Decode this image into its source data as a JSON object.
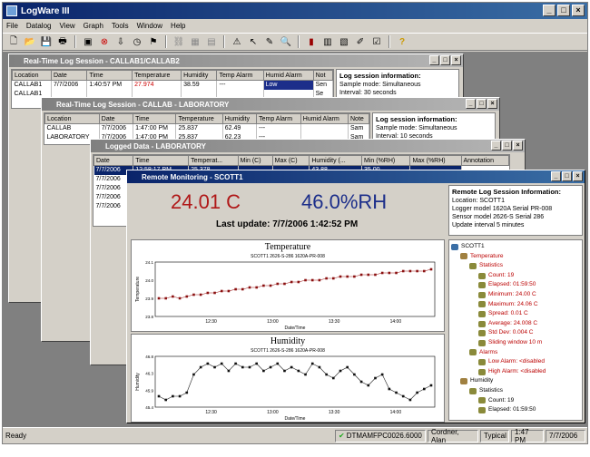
{
  "app": {
    "title": "LogWare III",
    "menu": [
      "File",
      "Datalog",
      "View",
      "Graph",
      "Tools",
      "Window",
      "Help"
    ]
  },
  "win1": {
    "title": "Real-Time Log Session - CALLAB1/CALLAB2",
    "cols": [
      "Location",
      "Date",
      "Time",
      "Temperature",
      "Humidity",
      "Temp Alarm",
      "Humid Alarm",
      "Not"
    ],
    "rows": [
      [
        "CALLAB1",
        "7/7/2006",
        "1:40:57 PM",
        "27.974",
        "38.59",
        "---",
        "Low",
        "Sen"
      ],
      [
        "CALLAB1",
        "",
        "",
        "",
        "",
        "",
        "",
        "Se"
      ]
    ],
    "info_title": "Log session information:",
    "info_lines": [
      "Sample mode: Simultaneous",
      "Interval: 30 seconds"
    ]
  },
  "win2": {
    "title": "Real-Time Log Session - CALLAB - LABORATORY",
    "cols": [
      "Location",
      "Date",
      "Time",
      "Temperature",
      "Humidity",
      "Temp Alarm",
      "Humid Alarm",
      "Note"
    ],
    "rows": [
      [
        "CALLAB",
        "7/7/2006",
        "1:47:00 PM",
        "25.837",
        "62.49",
        "---",
        "",
        "Sam"
      ],
      [
        "LABORATORY",
        "7/7/2006",
        "1:47:00 PM",
        "25.837",
        "62.23",
        "---",
        "",
        "Sam"
      ]
    ],
    "info_title": "Log session information:",
    "info_lines": [
      "Sample mode: Simultaneous",
      "Interval: 10 seconds"
    ]
  },
  "win3": {
    "title": "Logged Data - LABORATORY",
    "cols": [
      "Date",
      "Time",
      "Temperat...",
      "Min (C)",
      "Max (C)",
      "Humidity (...",
      "Min (%RH)",
      "Max (%RH)",
      "Annotation"
    ],
    "rows": [
      [
        "7/7/2006",
        "12:58:17 PM",
        "25.378",
        "",
        "",
        "43.88",
        "35.00",
        ""
      ],
      [
        "7/7/2006",
        "",
        "",
        "",
        "",
        "",
        "",
        ""
      ],
      [
        "7/7/2006",
        "",
        "",
        "",
        "",
        "",
        "",
        ""
      ],
      [
        "7/7/2006",
        "",
        "",
        "",
        "",
        "",
        "",
        ""
      ],
      [
        "7/7/2006",
        "",
        "",
        "",
        "",
        "",
        "",
        ""
      ]
    ]
  },
  "win4": {
    "title": "Remote Monitoring - SCOTT1",
    "temp": "24.01 C",
    "humid": "46.0%RH",
    "last_update": "Last update: 7/7/2006 1:42:52 PM",
    "info_title": "Remote Log Session Information:",
    "info_lines": [
      "Location: SCOTT1",
      "Logger model 1620A  Serial PR-008",
      "Sensor model 2626-S  Serial 286",
      "Update interval 5 minutes"
    ],
    "tree": [
      {
        "t": "SCOTT1",
        "lvl": 0,
        "cls": ""
      },
      {
        "t": "Temperature",
        "lvl": 1,
        "cls": "red"
      },
      {
        "t": "Statistics",
        "lvl": 2,
        "cls": "red"
      },
      {
        "t": "Count: 19",
        "lvl": 3,
        "cls": "red"
      },
      {
        "t": "Elapsed: 01:59:50",
        "lvl": 3,
        "cls": "red"
      },
      {
        "t": "Minimum: 24.00 C",
        "lvl": 3,
        "cls": "red"
      },
      {
        "t": "Maximum: 24.06 C",
        "lvl": 3,
        "cls": "red"
      },
      {
        "t": "Spread: 0.01 C",
        "lvl": 3,
        "cls": "red"
      },
      {
        "t": "Average: 24.008 C",
        "lvl": 3,
        "cls": "red"
      },
      {
        "t": "Std Dev: 0.004 C",
        "lvl": 3,
        "cls": "red"
      },
      {
        "t": "Sliding window 10 m",
        "lvl": 3,
        "cls": "red"
      },
      {
        "t": "Alarms",
        "lvl": 2,
        "cls": "red"
      },
      {
        "t": "Low Alarm: <disabled",
        "lvl": 3,
        "cls": "red"
      },
      {
        "t": "High Alarm: <disabled",
        "lvl": 3,
        "cls": "red"
      },
      {
        "t": "Humidity",
        "lvl": 1,
        "cls": ""
      },
      {
        "t": "Statistics",
        "lvl": 2,
        "cls": ""
      },
      {
        "t": "Count: 19",
        "lvl": 3,
        "cls": ""
      },
      {
        "t": "Elapsed: 01:59:50",
        "lvl": 3,
        "cls": ""
      }
    ]
  },
  "chart_data": [
    {
      "type": "line",
      "title": "Temperature",
      "subtitle": "SCOTT1   2626-S-286   1620A-PR-008",
      "xlabel": "Date/Time",
      "ylabel": "Temperature",
      "x": [
        "12:30",
        "13:00",
        "13:30",
        "14:00"
      ],
      "ylim": [
        23.8,
        24.1
      ],
      "series": [
        {
          "values": [
            23.9,
            23.9,
            23.91,
            23.9,
            23.91,
            23.92,
            23.92,
            23.93,
            23.93,
            23.94,
            23.94,
            23.95,
            23.95,
            23.96,
            23.96,
            23.97,
            23.97,
            23.98,
            23.98,
            23.99,
            23.99,
            24.0,
            24.0,
            24.0,
            24.01,
            24.01,
            24.02,
            24.02,
            24.02,
            24.03,
            24.03,
            24.03,
            24.04,
            24.04,
            24.04,
            24.05,
            24.05,
            24.05,
            24.05,
            24.06
          ]
        }
      ]
    },
    {
      "type": "line",
      "title": "Humidity",
      "subtitle": "SCOTT1   2626-S-286   1620A-PR-008",
      "xlabel": "Date/Time",
      "ylabel": "Humidity",
      "x": [
        "12:30",
        "13:00",
        "13:30",
        "14:00"
      ],
      "ylim": [
        45.4,
        46.8
      ],
      "series": [
        {
          "values": [
            45.7,
            45.6,
            45.7,
            45.7,
            45.8,
            46.3,
            46.5,
            46.6,
            46.5,
            46.6,
            46.4,
            46.6,
            46.5,
            46.5,
            46.6,
            46.4,
            46.5,
            46.6,
            46.4,
            46.5,
            46.4,
            46.3,
            46.6,
            46.5,
            46.3,
            46.2,
            46.4,
            46.5,
            46.3,
            46.1,
            46.0,
            46.2,
            46.3,
            45.9,
            45.8,
            45.7,
            45.6,
            45.8,
            45.9,
            46.0
          ]
        }
      ]
    }
  ],
  "status": {
    "ready": "Ready",
    "server": "DTMAMFPC0026.6000",
    "user": "Cordner, Alan",
    "mode": "Typical",
    "time": "1:47 PM",
    "date": "7/7/2006"
  }
}
